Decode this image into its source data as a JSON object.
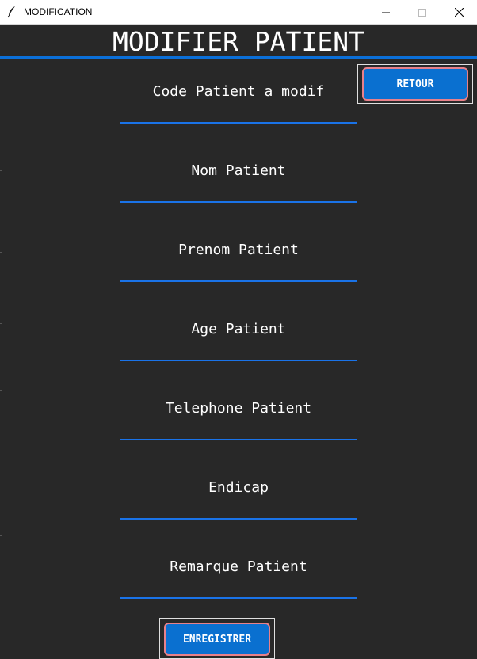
{
  "window": {
    "title": "MODIFICATION",
    "icons": [
      "feather-icon",
      "minimize-icon",
      "maximize-icon",
      "close-icon"
    ]
  },
  "page": {
    "title": "MODIFIER PATIENT"
  },
  "fields": [
    {
      "placeholder": "Code Patient a modif"
    },
    {
      "placeholder": "Nom Patient"
    },
    {
      "placeholder": "Prenom Patient"
    },
    {
      "placeholder": "Age Patient"
    },
    {
      "placeholder": "Telephone Patient"
    },
    {
      "placeholder": "Endicap"
    },
    {
      "placeholder": "Remarque Patient"
    }
  ],
  "buttons": {
    "back_label": "RETOUR",
    "save_label": "ENREGISTRER"
  },
  "colors": {
    "background": "#282828",
    "accent": "#1a73e8",
    "button": "#0a70d0",
    "button_border": "#e8818a",
    "text": "#ffffff"
  }
}
